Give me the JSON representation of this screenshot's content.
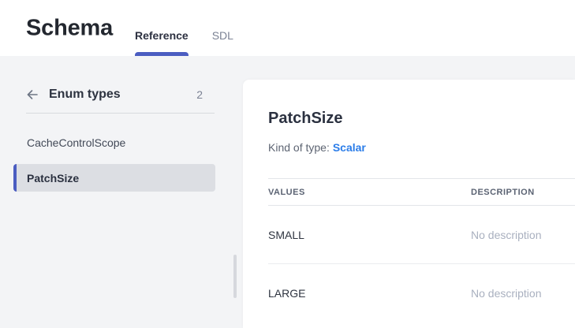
{
  "header": {
    "title": "Schema",
    "tabs": [
      {
        "label": "Reference",
        "active": true
      },
      {
        "label": "SDL",
        "active": false
      }
    ]
  },
  "sidebar": {
    "back_icon": "arrow-left",
    "heading": "Enum types",
    "count": "2",
    "items": [
      {
        "label": "CacheControlScope",
        "selected": false
      },
      {
        "label": "PatchSize",
        "selected": true
      }
    ]
  },
  "detail": {
    "title": "PatchSize",
    "kind_label": "Kind of type:",
    "kind_value": "Scalar",
    "table": {
      "columns": [
        "VALUES",
        "DESCRIPTION"
      ],
      "rows": [
        {
          "value": "SMALL",
          "description": "No description"
        },
        {
          "value": "LARGE",
          "description": "No description"
        }
      ]
    }
  },
  "colors": {
    "accent": "#4b5dc1",
    "link": "#2b7de9",
    "background": "#f3f4f6",
    "selected_item_bg": "#dcdee3",
    "card_bg": "#ffffff"
  }
}
